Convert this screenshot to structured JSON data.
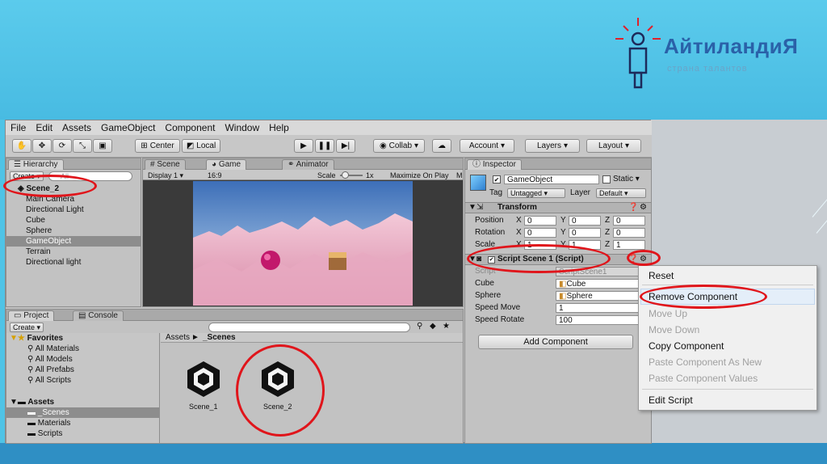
{
  "logo": {
    "name": "АйтиландиЯ",
    "tagline": "страна талантов"
  },
  "menubar": [
    "File",
    "Edit",
    "Assets",
    "GameObject",
    "Component",
    "Window",
    "Help"
  ],
  "toolbar": {
    "pivot": "Center",
    "space": "Local",
    "collab": "Collab",
    "account": "Account",
    "layers": "Layers",
    "layout": "Layout"
  },
  "hierarchy": {
    "tab": "Hierarchy",
    "create": "Create",
    "search_placeholder": "All",
    "scene": "Scene_2",
    "items": [
      "Main Camera",
      "Directional Light",
      "Cube",
      "Sphere",
      "GameObject",
      "Terrain",
      "Directional light"
    ]
  },
  "scene_tabs": {
    "scene": "Scene",
    "game": "Game",
    "animator": "Animator",
    "display": "Display 1",
    "aspect": "16:9",
    "scale_label": "Scale",
    "scale_value": "1x",
    "maximize": "Maximize On Play",
    "m": "M"
  },
  "project": {
    "tab_project": "Project",
    "tab_console": "Console",
    "create": "Create",
    "favorites": "Favorites",
    "fav_items": [
      "All Materials",
      "All Models",
      "All Prefabs",
      "All Scripts"
    ],
    "assets": "Assets",
    "asset_items": [
      "_Scenes",
      "Materials",
      "Scripts"
    ],
    "breadcrumb_root": "Assets",
    "breadcrumb_sep": "►",
    "breadcrumb_leaf": "_Scenes",
    "files": [
      "Scene_1",
      "Scene_2"
    ]
  },
  "inspector": {
    "tab": "Inspector",
    "object_name": "GameObject",
    "static_label": "Static",
    "tag_label": "Tag",
    "tag_value": "Untagged",
    "layer_label": "Layer",
    "layer_value": "Default",
    "transform_title": "Transform",
    "position_label": "Position",
    "rotation_label": "Rotation",
    "scale_label": "Scale",
    "position": {
      "x": "0",
      "y": "0",
      "z": "0"
    },
    "rotation": {
      "x": "0",
      "y": "0",
      "z": "0"
    },
    "scale": {
      "x": "1",
      "y": "1",
      "z": "1"
    },
    "x": "X",
    "y": "Y",
    "z": "Z",
    "script_title": "Script Scene 1 (Script)",
    "script_label": "Script",
    "script_value": "ScriptScene1",
    "cube_label": "Cube",
    "cube_value": "Cube",
    "sphere_label": "Sphere",
    "sphere_value": "Sphere",
    "speed_move_label": "Speed Move",
    "speed_move_value": "1",
    "speed_rotate_label": "Speed Rotate",
    "speed_rotate_value": "100",
    "add_component": "Add Component"
  },
  "context_menu": {
    "reset": "Reset",
    "remove": "Remove Component",
    "move_up": "Move Up",
    "move_down": "Move Down",
    "copy": "Copy Component",
    "paste_as_new": "Paste Component As New",
    "paste_values": "Paste Component Values",
    "edit_script": "Edit Script"
  },
  "colors": {
    "highlight": "#e0151b",
    "slide_blue": "#4fc3e6",
    "logo_blue": "#2a61a8"
  }
}
